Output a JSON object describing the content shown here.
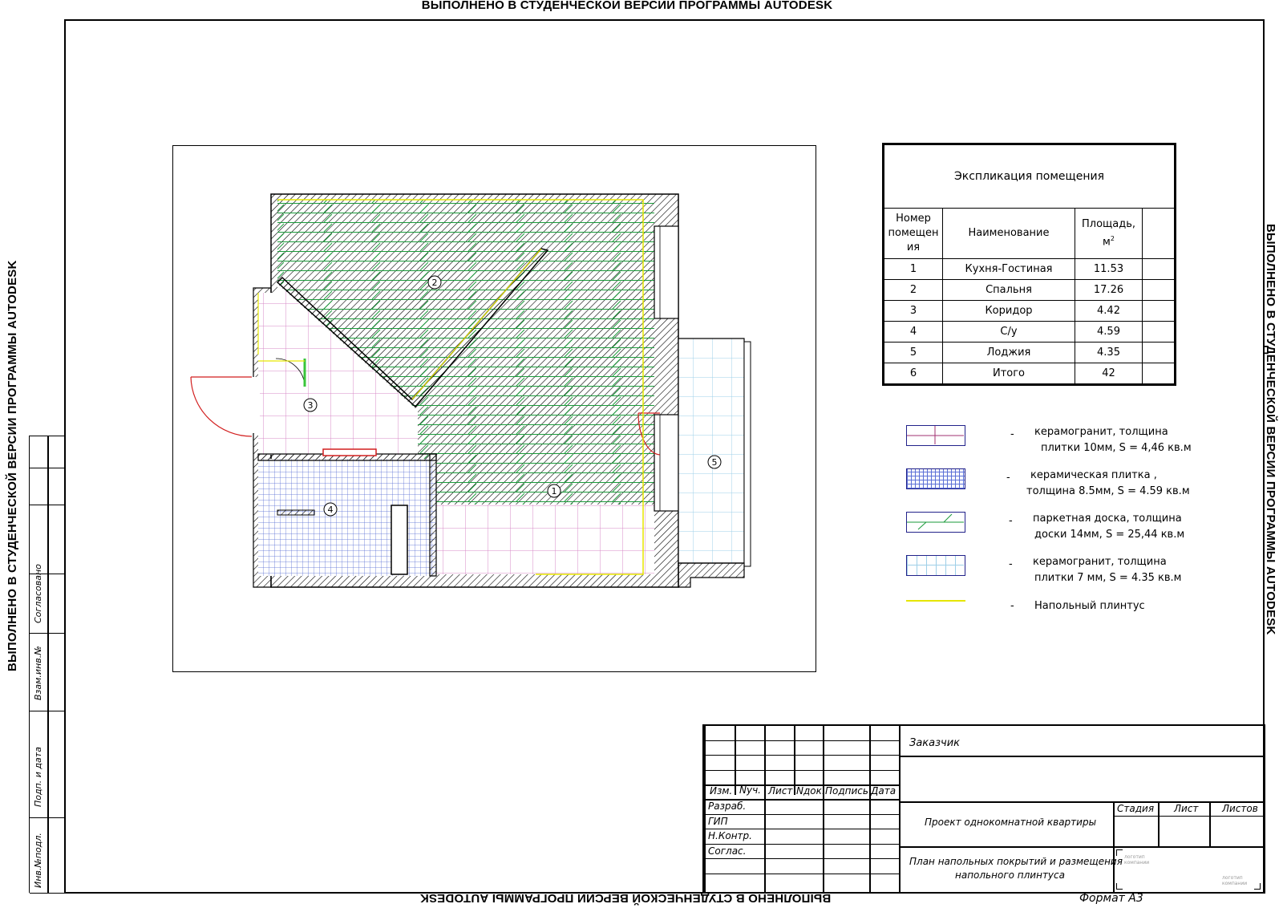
{
  "watermark": "ВЫПОЛНЕНО В СТУДЕНЧЕСКОЙ ВЕРСИИ ПРОГРАММЫ AUTODESK",
  "side_stamp": {
    "soglasovano": "Согласовано",
    "vzam": "Взам.инв.№",
    "podp": "Подп. и дата",
    "inv": "Инв.№подл."
  },
  "plan": {
    "room_labels": [
      "1",
      "2",
      "3",
      "4",
      "5"
    ],
    "colors": {
      "parquet": "#1a9a3a",
      "ceramic_granite": "#d78ac7",
      "ceramic_tile": "#5a6fd6",
      "loggia_tile": "#9ecfe8",
      "skirting": "#e6e600",
      "door": "#d21f1f",
      "wall": "#000000"
    }
  },
  "explication": {
    "title": "Экспликация помещения",
    "headers": [
      "Номер помещения",
      "Наименование",
      "Площадь, м²",
      ""
    ],
    "header_num": "Номер помещен ия",
    "header_name": "Наименование",
    "header_area_1": "Площадь,",
    "header_area_2": "м",
    "header_area_sup": "2",
    "rows": [
      {
        "num": "1",
        "name": "Кухня-Гостиная",
        "area": "11.53"
      },
      {
        "num": "2",
        "name": "Спальня",
        "area": "17.26"
      },
      {
        "num": "3",
        "name": "Коридор",
        "area": "4.42"
      },
      {
        "num": "4",
        "name": "С/у",
        "area": "4.59"
      },
      {
        "num": "5",
        "name": "Лоджия",
        "area": "4.35"
      },
      {
        "num": "6",
        "name": "Итого",
        "area": "42"
      }
    ]
  },
  "legend": [
    {
      "dash": "-",
      "line1": "керамогранит, толщина",
      "line2": "плитки 10мм, S = 4,46 кв.м"
    },
    {
      "dash": "-",
      "line1": "керамическая плитка ,",
      "line2": "толщина  8.5мм, S = 4.59 кв.м"
    },
    {
      "dash": "-",
      "line1": "паркетная доска, толщина",
      "line2": "доски 14мм, S = 25,44 кв.м"
    },
    {
      "dash": "-",
      "line1": "керамогранит, толщина",
      "line2": "плитки 7 мм, S = 4.35 кв.м"
    },
    {
      "dash": "-",
      "line1": "Напольный плинтус",
      "line2": ""
    }
  ],
  "title_block": {
    "cols": [
      "Изм.",
      "Nуч.",
      "Лист",
      "Nдок.",
      "Подпись",
      "Дата"
    ],
    "roles": [
      "Разраб.",
      "ГИП",
      "Н.Контр.",
      "Соглас."
    ],
    "customer": "Заказчик",
    "project": "Проект однокомнатной квартиры",
    "sheet_title_1": "План напольных покрытий и размещения",
    "sheet_title_2": "напольного плинтуса",
    "stage": "Стадия",
    "sheet": "Лист",
    "sheets": "Листов",
    "logo_1": "логотип компании",
    "logo_2": "логотип компании"
  },
  "format": "Формат А3"
}
